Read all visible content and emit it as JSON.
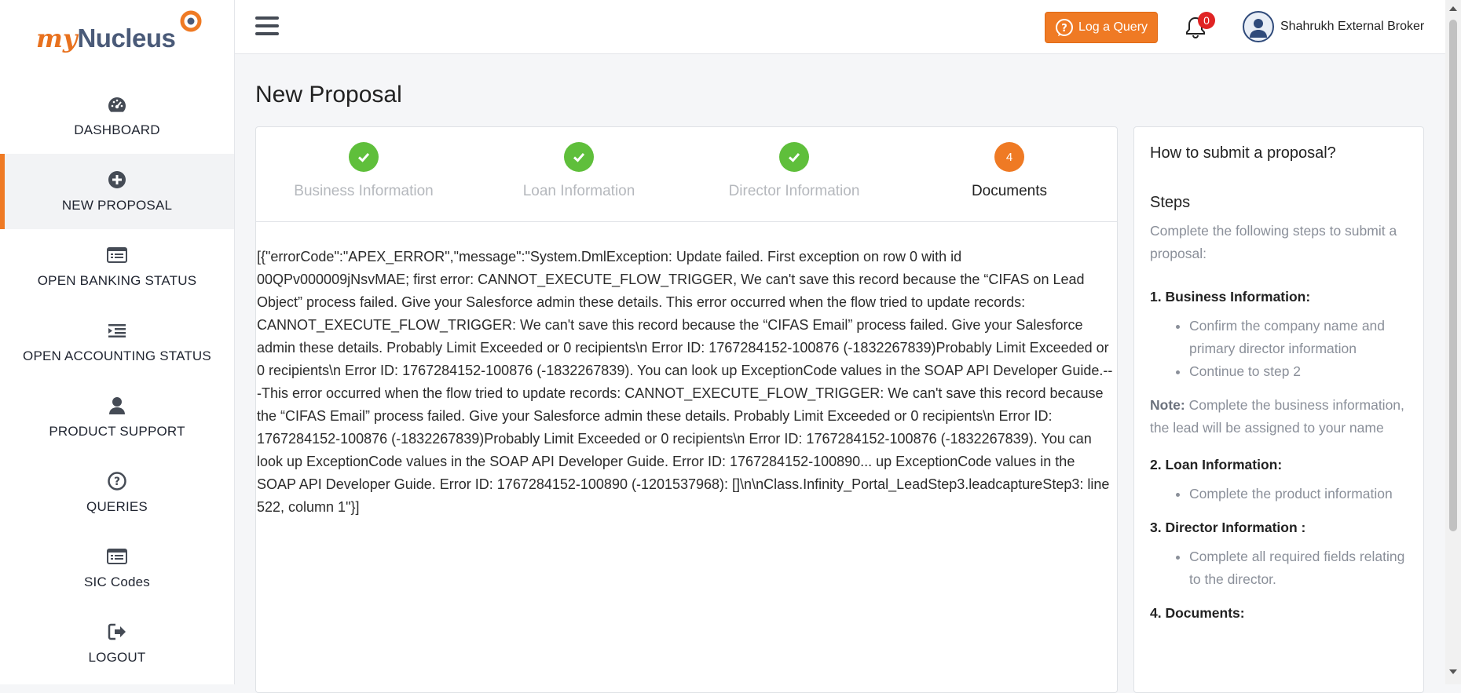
{
  "app": {
    "logo_my": "my",
    "logo_nucleus": "Nucleus"
  },
  "sidebar": {
    "items": [
      {
        "label": "DASHBOARD",
        "icon": "dashboard-icon"
      },
      {
        "label": "NEW PROPOSAL",
        "icon": "plus-circle-icon",
        "active": true
      },
      {
        "label": "OPEN BANKING STATUS",
        "icon": "list-card-icon"
      },
      {
        "label": "OPEN ACCOUNTING STATUS",
        "icon": "indent-icon"
      },
      {
        "label": "PRODUCT SUPPORT",
        "icon": "user-icon"
      },
      {
        "label": "QUERIES",
        "icon": "question-circle-icon"
      },
      {
        "label": "SIC Codes",
        "icon": "list-card-icon"
      },
      {
        "label": "LOGOUT",
        "icon": "sign-out-icon"
      }
    ]
  },
  "header": {
    "query_button": "Log a Query",
    "notifications_count": "0",
    "user_name": "Shahrukh External Broker"
  },
  "page": {
    "title": "New Proposal"
  },
  "stepper": {
    "steps": [
      {
        "label": "Business Information",
        "state": "done"
      },
      {
        "label": "Loan Information",
        "state": "done"
      },
      {
        "label": "Director Information",
        "state": "done"
      },
      {
        "label": "Documents",
        "state": "current",
        "number": "4"
      }
    ]
  },
  "error_message": "[{\"errorCode\":\"APEX_ERROR\",\"message\":\"System.DmlException: Update failed. First exception on row 0 with id 00QPv000009jNsvMAE; first error: CANNOT_EXECUTE_FLOW_TRIGGER, We can't save this record because the “CIFAS on Lead Object” process failed. Give your Salesforce admin these details. This error occurred when the flow tried to update records: CANNOT_EXECUTE_FLOW_TRIGGER: We can't save this record because the “CIFAS Email” process failed. Give your Salesforce admin these details. Probably Limit Exceeded or 0 recipients\\n Error ID: 1767284152-100876 (-1832267839)Probably Limit Exceeded or 0 recipients\\n Error ID: 1767284152-100876 (-1832267839). You can look up ExceptionCode values in the SOAP API Developer Guide.---This error occurred when the flow tried to update records: CANNOT_EXECUTE_FLOW_TRIGGER: We can't save this record because the “CIFAS Email” process failed. Give your Salesforce admin these details. Probably Limit Exceeded or 0 recipients\\n Error ID: 1767284152-100876 (-1832267839)Probably Limit Exceeded or 0 recipients\\n Error ID: 1767284152-100876 (-1832267839). You can look up ExceptionCode values in the SOAP API Developer Guide. Error ID: 1767284152-100890... up ExceptionCode values in the SOAP API Developer Guide. Error ID: 1767284152-100890 (-1201537968): []\\n\\nClass.Infinity_Portal_LeadStep3.leadcaptureStep3: line 522, column 1\"}]",
  "help": {
    "title": "How to submit a proposal?",
    "steps_heading": "Steps",
    "intro": "Complete the following steps to submit a proposal:",
    "sections": [
      {
        "heading": "1. Business Information:",
        "bullets": [
          "Confirm the company name and primary director information",
          "Continue to step 2"
        ]
      },
      {
        "heading": "2. Loan Information:",
        "bullets": [
          "Complete the product information"
        ]
      },
      {
        "heading": "3. Director Information :",
        "bullets": [
          "Complete all required fields relating to the director."
        ]
      },
      {
        "heading": "4. Documents:",
        "bullets": []
      }
    ],
    "note_label": "Note:",
    "note_text": " Complete the business information, the lead will be assigned to your name"
  },
  "colors": {
    "accent": "#ef7a24",
    "success": "#5fbf3b",
    "badge": "#e02424"
  }
}
